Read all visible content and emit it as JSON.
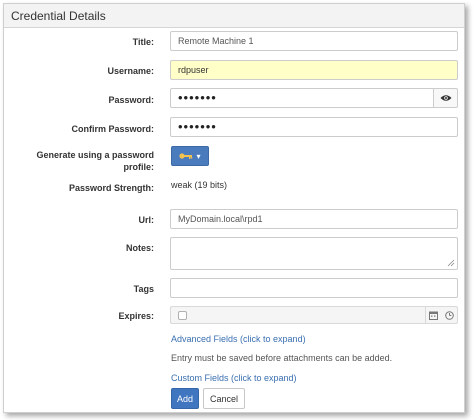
{
  "dialog": {
    "title": "Credential Details"
  },
  "form": {
    "title_label": "Title:",
    "title_value": "Remote Machine 1",
    "username_label": "Username:",
    "username_value": "rdpuser",
    "password_label": "Password:",
    "password_value": "•••••••",
    "confirm_label": "Confirm Password:",
    "confirm_value": "•••••••",
    "generate_label_line1": "Generate using a password",
    "generate_label_line2": "profile:",
    "strength_label": "Password Strength:",
    "strength_value": "weak (19 bits)",
    "url_label": "Url:",
    "url_value": "MyDomain.local\\rpd1",
    "notes_label": "Notes:",
    "notes_value": "",
    "tags_label": "Tags",
    "tags_value": "",
    "expires_label": "Expires:",
    "expires_checked": false
  },
  "links": {
    "advanced": "Advanced Fields (click to expand)",
    "custom": "Custom Fields (click to expand)"
  },
  "attachments_note": "Entry must be saved before attachments can be added.",
  "buttons": {
    "add": "Add",
    "cancel": "Cancel"
  },
  "icons": {
    "show_password": "eye-icon",
    "profile": "key-icon",
    "calendar": "calendar-icon",
    "clock": "clock-icon"
  },
  "colors": {
    "accent": "#3f76bf",
    "username_bg": "#ffffc7",
    "link": "#3a6fb0"
  }
}
